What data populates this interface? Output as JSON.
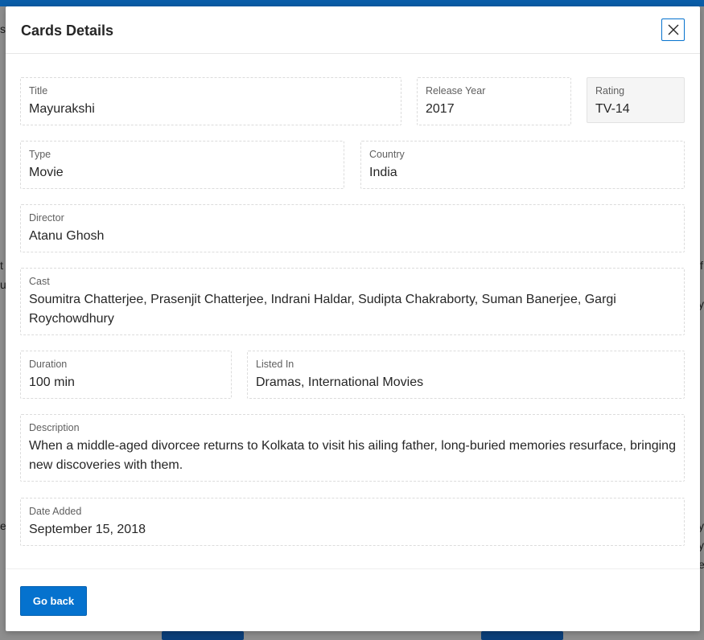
{
  "dialog": {
    "title": "Cards Details",
    "close_label": "Close",
    "go_back_label": "Go back"
  },
  "fields": {
    "title": {
      "label": "Title",
      "value": "Mayurakshi"
    },
    "release_year": {
      "label": "Release Year",
      "value": "2017"
    },
    "rating": {
      "label": "Rating",
      "value": "TV-14"
    },
    "type": {
      "label": "Type",
      "value": "Movie"
    },
    "country": {
      "label": "Country",
      "value": "India"
    },
    "director": {
      "label": "Director",
      "value": "Atanu Ghosh"
    },
    "cast": {
      "label": "Cast",
      "value": "Soumitra Chatterjee, Prasenjit Chatterjee, Indrani Haldar, Sudipta Chakraborty, Suman Banerjee, Gargi Roychowdhury"
    },
    "duration": {
      "label": "Duration",
      "value": "100 min"
    },
    "listed_in": {
      "label": "Listed In",
      "value": "Dramas, International Movies"
    },
    "description": {
      "label": "Description",
      "value": "When a middle-aged divorcee returns to Kolkata to visit his ailing father, long-buried memories resurface, bringing new discoveries with them."
    },
    "date_added": {
      "label": "Date Added",
      "value": "September 15, 2018"
    }
  },
  "background": {
    "fragments": [
      "s",
      "t",
      "u",
      "e",
      "y",
      "f",
      "y",
      "e",
      "y"
    ]
  },
  "colors": {
    "accent": "#0572ce",
    "overlay": "#8e8e8e",
    "header_bar": "#0a5da8"
  }
}
